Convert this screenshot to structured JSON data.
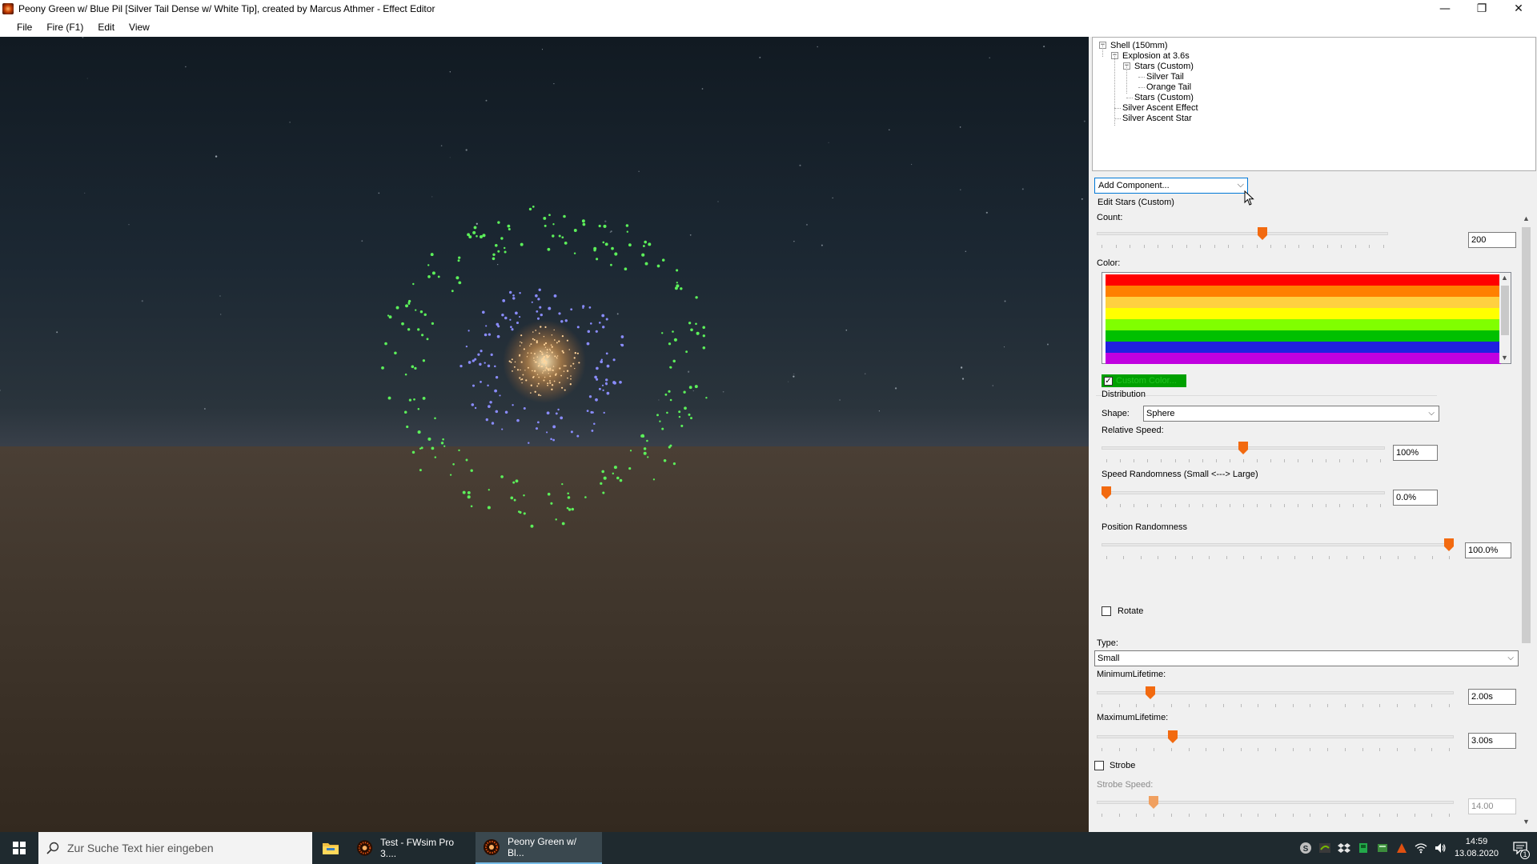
{
  "window": {
    "title": "Peony Green w/ Blue Pil [Silver Tail Dense w/ White Tip], created by Marcus Athmer - Effect Editor",
    "controls": [
      "—",
      "❐",
      "✕"
    ]
  },
  "menu": [
    "File",
    "Fire (F1)",
    "Edit",
    "View"
  ],
  "tree": [
    {
      "label": "Shell (150mm)",
      "level": 0,
      "toggle": "−"
    },
    {
      "label": "Explosion at 3.6s",
      "level": 1,
      "toggle": "−"
    },
    {
      "label": "Stars (Custom)",
      "level": 2,
      "toggle": "−"
    },
    {
      "label": "Silver Tail",
      "level": 3,
      "toggle": ""
    },
    {
      "label": "Orange Tail",
      "level": 3,
      "toggle": ""
    },
    {
      "label": "Stars (Custom)",
      "level": 2,
      "toggle": ""
    },
    {
      "label": "Silver Ascent Effect",
      "level": 1,
      "toggle": ""
    },
    {
      "label": "Silver Ascent Star",
      "level": 1,
      "toggle": ""
    }
  ],
  "add_component": {
    "label": "Add Component...",
    "chevron": "⌵"
  },
  "editor": {
    "group_title": "Edit Stars (Custom)",
    "count_label": "Count:",
    "count_value": "200",
    "count_fraction": 0.57,
    "color_label": "Color:",
    "colors": [
      "#ff0000",
      "#ff8000",
      "#ffd040",
      "#ffff00",
      "#80ff00",
      "#00c000",
      "#2020e0",
      "#c000e0"
    ],
    "custom_color_label": "Custom Color...",
    "custom_color_checked": "✓",
    "distribution_label": "Distribution",
    "shape_label": "Shape:",
    "shape_value": "Sphere",
    "relative_speed_label": "Relative Speed:",
    "relative_speed_value": "100%",
    "relative_speed_fraction": 0.5,
    "speed_randomness_label": "Speed Randomness (Small <---> Large)",
    "speed_randomness_value": "0.0%",
    "speed_randomness_fraction": 0.0,
    "position_randomness_label": "Position Randomness",
    "position_randomness_value": "100.0%",
    "position_randomness_fraction": 1.0,
    "rotate_label": "Rotate",
    "type_label": "Type:",
    "type_value": "Small",
    "min_lifetime_label": "MinimumLifetime:",
    "min_lifetime_value": "2.00s",
    "min_lifetime_fraction": 0.14,
    "max_lifetime_label": "MaximumLifetime:",
    "max_lifetime_value": "3.00s",
    "max_lifetime_fraction": 0.205,
    "strobe_label": "Strobe",
    "strobe_speed_label": "Strobe Speed:",
    "strobe_speed_value": "14.00",
    "strobe_speed_fraction": 0.15
  },
  "taskbar": {
    "search_placeholder": "Zur Suche Text hier eingeben",
    "apps": [
      {
        "label": "Test - FWsim Pro 3....",
        "active": false
      },
      {
        "label": "Peony Green w/ Bl...",
        "active": true
      }
    ],
    "time": "14:59",
    "date": "13.08.2020",
    "notification_count": "1"
  },
  "colors": {
    "accent_orange": "#f26a10",
    "selection_green": "#00a000",
    "taskbar_bg": "#1f2a2f"
  }
}
